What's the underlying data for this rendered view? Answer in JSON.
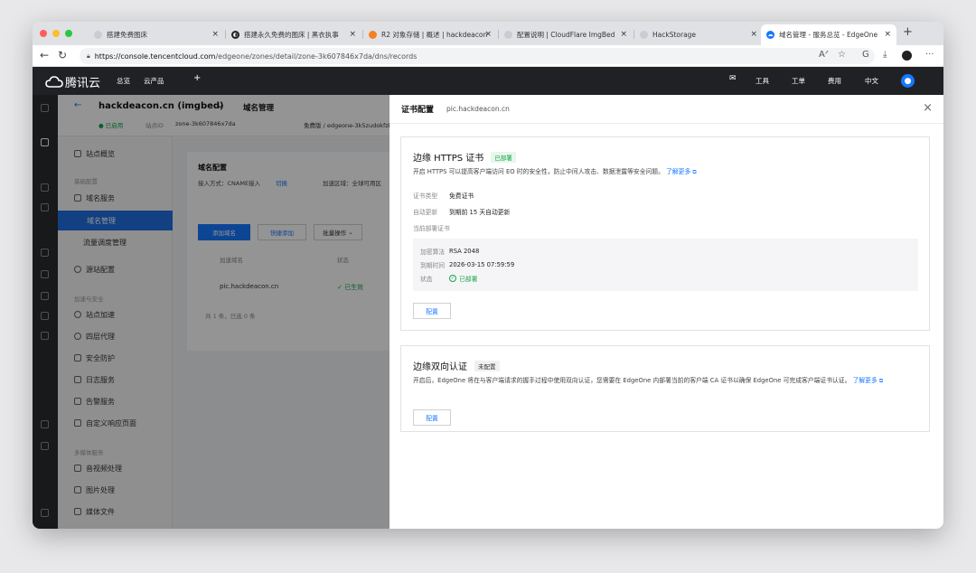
{
  "browser": {
    "tabs": [
      {
        "title": "搭建免费图床",
        "favicon_color": "#c9ccd1"
      },
      {
        "title": "搭建永久免费的图床 | 黑衣执事",
        "favicon_color": "#222222"
      },
      {
        "title": "R2 对象存储 | 概述 | hackdeacon",
        "favicon_color": "#f48120"
      },
      {
        "title": "配置说明 | CloudFlare ImgBed",
        "favicon_color": "#c9ccd1"
      },
      {
        "title": "HackStorage",
        "favicon_color": "#c9ccd1"
      },
      {
        "title": "域名管理 - 服务总览 - EdgeOne",
        "favicon_color": "#1677ff"
      }
    ],
    "url_host": "https://console.tencentcloud.com",
    "url_path": "/edgeone/zones/detail/zone-3k607846x7da/dns/records"
  },
  "topnav": {
    "logo": "腾讯云",
    "items": [
      "总览",
      "云产品",
      "+"
    ],
    "right": [
      "工具",
      "工单",
      "费用",
      "中文"
    ]
  },
  "sidebar": {
    "items": [
      "站点概览",
      "基础配置",
      "域名服务",
      "域名管理",
      "流量调度管理",
      "源站配置",
      "加速与安全",
      "站点加速",
      "四层代理",
      "安全防护",
      "日志服务",
      "告警服务",
      "自定义响应页面",
      "多媒体服务",
      "音视频处理",
      "图片处理",
      "媒体文件"
    ]
  },
  "background": {
    "zone_title": "hackdeacon.cn (imgbed)",
    "breadcrumb": "域名管理",
    "status": "已启用",
    "zone_id_label": "站点ID",
    "zone_id": "zone-3k607846x7da",
    "plan": "免费版 / edgeone-3k5zudokfzbf",
    "section_title": "域名配置",
    "access_mode": "接入方式：CNAME接入",
    "switch": "切换",
    "region": "加速区域：全球可用区",
    "btn_add": "添加域名",
    "btn_quick": "快捷添加",
    "btn_batch": "批量操作",
    "col_domain": "加速域名",
    "col_status": "状态",
    "row_domain": "pic.hackdeacon.cn",
    "row_status": "已生效",
    "pagination": "共 1 条，已选 0 条"
  },
  "drawer": {
    "title": "证书配置",
    "domain": "pic.hackdeacon.cn",
    "https_card": {
      "title": "边缘 HTTPS 证书",
      "badge": "已部署",
      "desc": "开启 HTTPS 可以提高客户端访问 EO 时的安全性，防止中间人攻击、数据泄露等安全问题。",
      "learn_more": "了解更多",
      "cert_type_label": "证书类型",
      "cert_type": "免费证书",
      "auto_renew_label": "自动更新",
      "auto_renew": "到期前 15 天自动更新",
      "current_label": "当前部署证书",
      "algo_label": "加密算法",
      "algo": "RSA 2048",
      "expire_label": "到期时间",
      "expire": "2026-03-15 07:59:59",
      "status_label": "状态",
      "status": "已部署",
      "button": "配置"
    },
    "mtls_card": {
      "title": "边缘双向认证",
      "badge": "未配置",
      "desc": "开启后，EdgeOne 将在与客户端请求的握手过程中使用双向认证，您需要在 EdgeOne 内部署当前的客户端 CA 证书以确保 EdgeOne 可完成客户端证书认证。",
      "learn_more_1": "了解",
      "learn_more_2": "更多",
      "button": "配置"
    }
  }
}
